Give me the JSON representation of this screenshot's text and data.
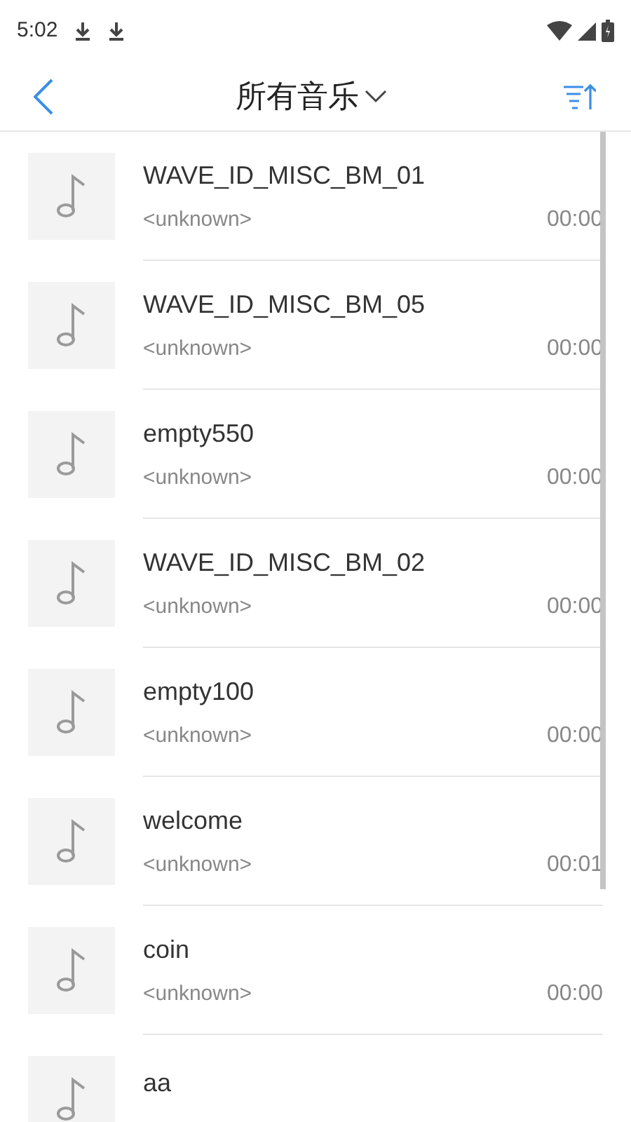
{
  "status_bar": {
    "time": "5:02"
  },
  "header": {
    "title": "所有音乐"
  },
  "songs": [
    {
      "title": "WAVE_ID_MISC_BM_01",
      "artist": "<unknown>",
      "duration": "00:00"
    },
    {
      "title": "WAVE_ID_MISC_BM_05",
      "artist": "<unknown>",
      "duration": "00:00"
    },
    {
      "title": "empty550",
      "artist": "<unknown>",
      "duration": "00:00"
    },
    {
      "title": "WAVE_ID_MISC_BM_02",
      "artist": "<unknown>",
      "duration": "00:00"
    },
    {
      "title": "empty100",
      "artist": "<unknown>",
      "duration": "00:00"
    },
    {
      "title": "welcome",
      "artist": "<unknown>",
      "duration": "00:01"
    },
    {
      "title": "coin",
      "artist": "<unknown>",
      "duration": "00:00"
    },
    {
      "title": "aa"
    }
  ]
}
